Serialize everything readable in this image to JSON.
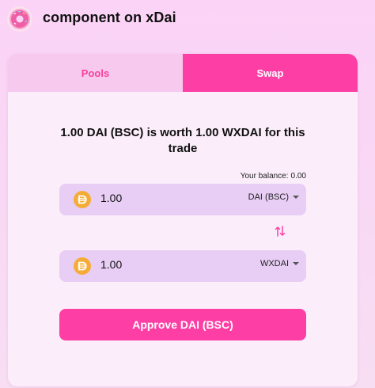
{
  "header": {
    "title": "component on xDai",
    "logo_icon": "donut-logo-icon"
  },
  "tabs": [
    {
      "label": "Pools",
      "active": false
    },
    {
      "label": "Swap",
      "active": true
    }
  ],
  "trade": {
    "message": "1.00 DAI (BSC) is worth 1.00 WXDAI for this trade"
  },
  "balance": {
    "label": "Your balance:",
    "value": "0.00"
  },
  "from": {
    "amount": "1.00",
    "token": "DAI (BSC)",
    "icon": "dai-coin-icon"
  },
  "to": {
    "amount": "1.00",
    "token": "WXDAI",
    "icon": "dai-coin-icon"
  },
  "swap_icon": "swap-arrows-icon",
  "action": {
    "label": "Approve DAI (BSC)"
  },
  "colors": {
    "accent": "#fd3fa5",
    "tab_inactive_bg": "#f7c9ef",
    "tab_inactive_text": "#f7409c",
    "input_bg": "#e8cef5",
    "coin": "#f5ac37"
  }
}
